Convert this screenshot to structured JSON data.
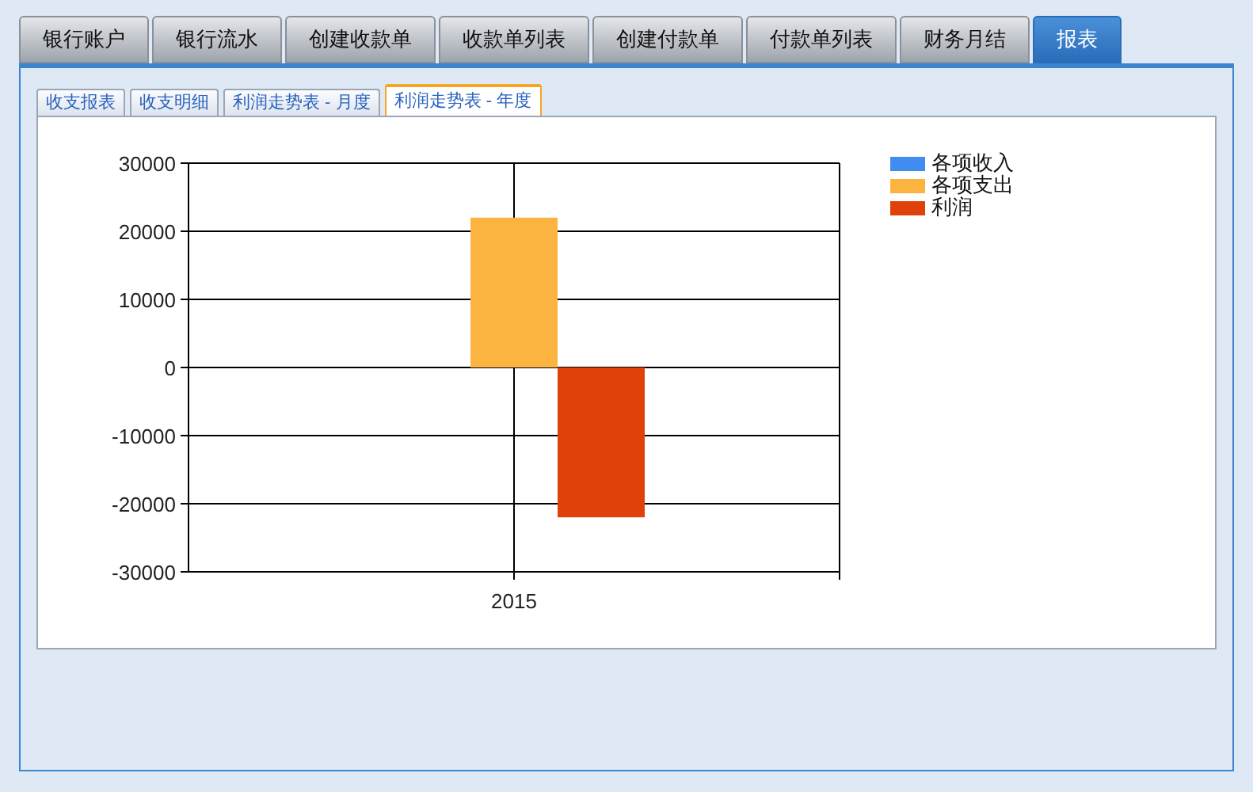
{
  "tabs": [
    {
      "label": "银行账户",
      "selected": false
    },
    {
      "label": "银行流水",
      "selected": false
    },
    {
      "label": "创建收款单",
      "selected": false
    },
    {
      "label": "收款单列表",
      "selected": false
    },
    {
      "label": "创建付款单",
      "selected": false
    },
    {
      "label": "付款单列表",
      "selected": false
    },
    {
      "label": "财务月结",
      "selected": false
    },
    {
      "label": "报表",
      "selected": true
    }
  ],
  "sub_tabs": [
    {
      "label": "收支报表",
      "selected": false
    },
    {
      "label": "收支明细",
      "selected": false
    },
    {
      "label": "利润走势表 - 月度",
      "selected": false
    },
    {
      "label": "利润走势表 - 年度",
      "selected": true
    }
  ],
  "chart_data": {
    "type": "bar",
    "categories": [
      "2015"
    ],
    "series": [
      {
        "name": "各项收入",
        "color": "#418cf0",
        "values": [
          0
        ]
      },
      {
        "name": "各项支出",
        "color": "#fcb441",
        "values": [
          22000
        ]
      },
      {
        "name": "利润",
        "color": "#e0400a",
        "values": [
          -22000
        ]
      }
    ],
    "grid": true,
    "ylim": [
      -30000,
      30000
    ],
    "yticks": [
      -30000,
      -20000,
      -10000,
      0,
      10000,
      20000,
      30000
    ]
  }
}
